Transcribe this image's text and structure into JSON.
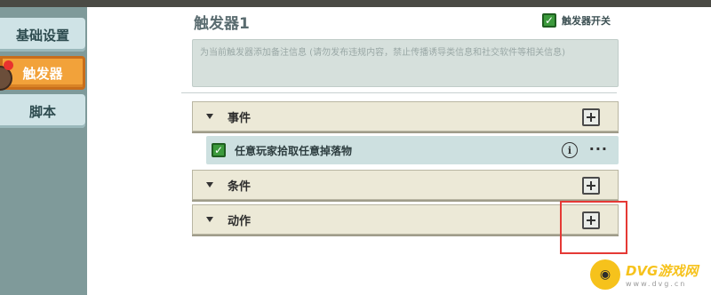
{
  "sidebar": {
    "items": [
      {
        "label": "基础设置",
        "active": false
      },
      {
        "label": "触发器",
        "active": true
      },
      {
        "label": "脚本",
        "active": false
      }
    ]
  },
  "trigger": {
    "title": "触发器1",
    "enabled": true,
    "switch_label": "触发器开关",
    "note_placeholder": "为当前触发器添加备注信息 (请勿发布违规内容，禁止传播诱导类信息和社交软件等相关信息)"
  },
  "sections": {
    "events": {
      "label": "事件"
    },
    "conditions": {
      "label": "条件"
    },
    "actions": {
      "label": "动作"
    }
  },
  "event_item": {
    "label": "任意玩家拾取任意掉落物",
    "checked": true,
    "more": "···"
  },
  "icons": {
    "info": "i",
    "check": "✓"
  },
  "watermark": {
    "main": "DVG游戏网",
    "sub": "www.dvg.cn"
  },
  "colors": {
    "active_tab": "#f2a23a",
    "checkbox": "#3c9a3c",
    "highlight": "#e53935",
    "watermark": "#f6c21c"
  }
}
